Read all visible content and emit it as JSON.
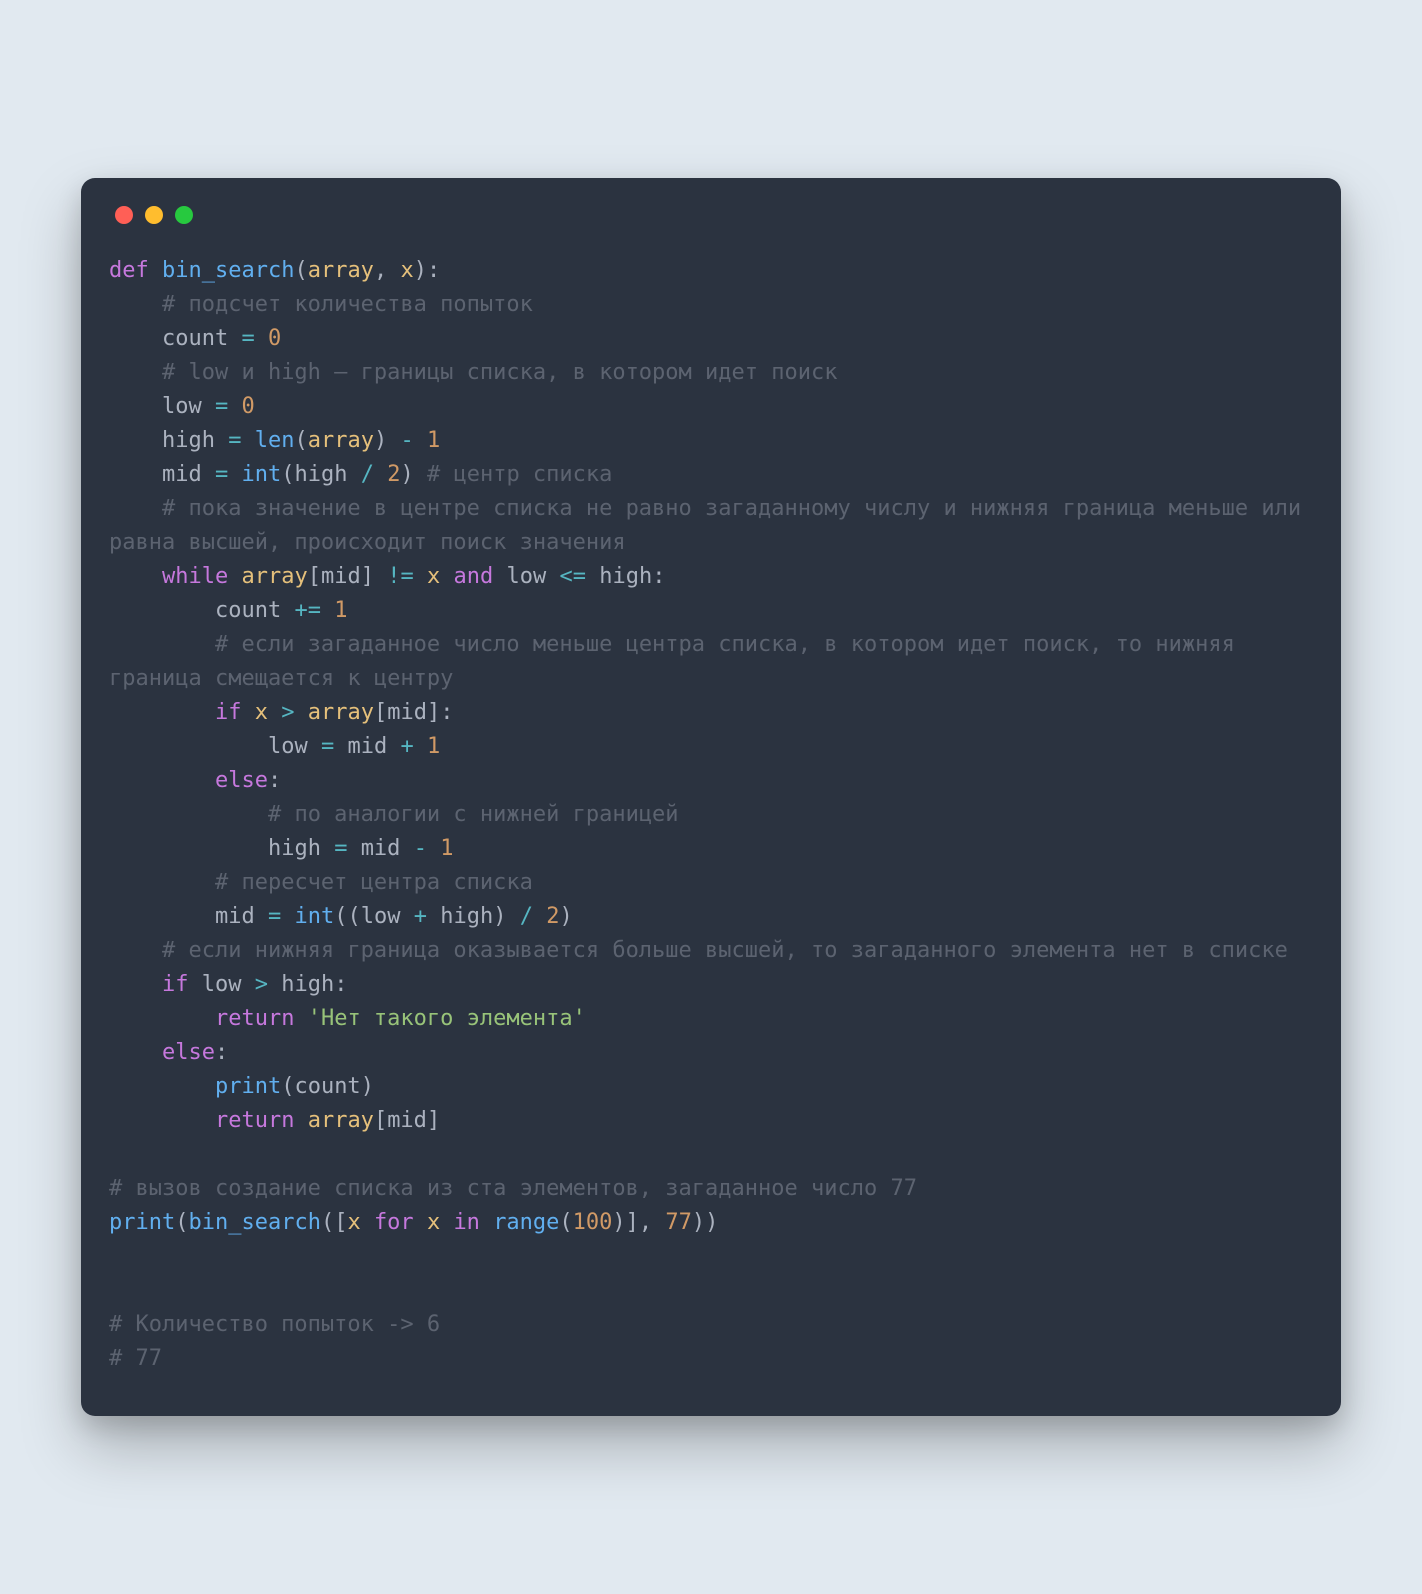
{
  "window": {
    "traffic_lights": [
      "red",
      "yellow",
      "green"
    ]
  },
  "code": {
    "l01": {
      "def": "def",
      "sp": " ",
      "fn": "bin_search",
      "lp": "(",
      "p1": "array",
      "c1": ",",
      "sp2": " ",
      "p2": "x",
      "rp": ")",
      "colon": ":"
    },
    "l02": {
      "indent": "    ",
      "cmt": "# подсчет количества попыток"
    },
    "l03": {
      "indent": "    ",
      "v": "count",
      "sp": " ",
      "eq": "=",
      "sp2": " ",
      "n": "0"
    },
    "l04": {
      "indent": "    ",
      "cmt": "# low и high – границы списка, в котором идет поиск"
    },
    "l05": {
      "indent": "    ",
      "v": "low",
      "sp": " ",
      "eq": "=",
      "sp2": " ",
      "n": "0"
    },
    "l06": {
      "indent": "    ",
      "v": "high",
      "sp": " ",
      "eq": "=",
      "sp2": " ",
      "len": "len",
      "lp": "(",
      "arr": "array",
      "rp": ")",
      "sp3": " ",
      "minus": "-",
      "sp4": " ",
      "n": "1"
    },
    "l07": {
      "indent": "    ",
      "v": "mid",
      "sp": " ",
      "eq": "=",
      "sp2": " ",
      "int": "int",
      "lp": "(",
      "high": "high",
      "sp3": " ",
      "div": "/",
      "sp4": " ",
      "n": "2",
      "rp": ")",
      "sp5": " ",
      "cmt": "# центр списка"
    },
    "l08": {
      "indent": "    ",
      "cmt": "# пока значение в центре списка не равно загаданному числу и нижняя граница меньше или равна высшей, происходит поиск значения"
    },
    "l09": {
      "indent": "    ",
      "while": "while",
      "sp": " ",
      "arr": "array",
      "lb": "[",
      "mid": "mid",
      "rb": "]",
      "sp2": " ",
      "ne": "!=",
      "sp3": " ",
      "x": "x",
      "sp4": " ",
      "and": "and",
      "sp5": " ",
      "low": "low",
      "sp6": " ",
      "le": "<=",
      "sp7": " ",
      "high": "high",
      "colon": ":"
    },
    "l10": {
      "indent": "        ",
      "v": "count",
      "sp": " ",
      "pe": "+=",
      "sp2": " ",
      "n": "1"
    },
    "l11": {
      "indent": "        ",
      "cmt": "# если загаданное число меньше центра списка, в котором идет поиск, то нижняя граница смещается к центру"
    },
    "l12": {
      "indent": "        ",
      "if": "if",
      "sp": " ",
      "x": "x",
      "sp2": " ",
      "gt": ">",
      "sp3": " ",
      "arr": "array",
      "lb": "[",
      "mid": "mid",
      "rb": "]",
      "colon": ":"
    },
    "l13": {
      "indent": "            ",
      "v": "low",
      "sp": " ",
      "eq": "=",
      "sp2": " ",
      "mid": "mid",
      "sp3": " ",
      "plus": "+",
      "sp4": " ",
      "n": "1"
    },
    "l14": {
      "indent": "        ",
      "else": "else",
      "colon": ":"
    },
    "l15": {
      "indent": "            ",
      "cmt": "# по аналогии с нижней границей"
    },
    "l16": {
      "indent": "            ",
      "v": "high",
      "sp": " ",
      "eq": "=",
      "sp2": " ",
      "mid": "mid",
      "sp3": " ",
      "minus": "-",
      "sp4": " ",
      "n": "1"
    },
    "l17": {
      "indent": "        ",
      "cmt": "# пересчет центра списка"
    },
    "l18": {
      "indent": "        ",
      "v": "mid",
      "sp": " ",
      "eq": "=",
      "sp2": " ",
      "int": "int",
      "lp": "(",
      "lp2": "(",
      "low": "low",
      "sp3": " ",
      "plus": "+",
      "sp4": " ",
      "high": "high",
      "rp2": ")",
      "sp5": " ",
      "div": "/",
      "sp6": " ",
      "n": "2",
      "rp": ")"
    },
    "l19": {
      "indent": "    ",
      "cmt": "# если нижняя граница оказывается больше высшей, то загаданного элемента нет в списке"
    },
    "l20": {
      "indent": "    ",
      "if": "if",
      "sp": " ",
      "low": "low",
      "sp2": " ",
      "gt": ">",
      "sp3": " ",
      "high": "high",
      "colon": ":"
    },
    "l21": {
      "indent": "        ",
      "ret": "return",
      "sp": " ",
      "str": "'Нет такого элемента'"
    },
    "l22": {
      "indent": "    ",
      "else": "else",
      "colon": ":"
    },
    "l23": {
      "indent": "        ",
      "pr": "print",
      "lp": "(",
      "cnt": "count",
      "rp": ")"
    },
    "l24": {
      "indent": "        ",
      "ret": "return",
      "sp": " ",
      "arr": "array",
      "lb": "[",
      "mid": "mid",
      "rb": "]"
    },
    "l25": {
      "blank": ""
    },
    "l26": {
      "cmt": "# вызов создание списка из ста элементов, загаданное число 77"
    },
    "l27": {
      "pr": "print",
      "lp": "(",
      "fn": "bin_search",
      "lp2": "(",
      "lb": "[",
      "x1": "x",
      "sp": " ",
      "for": "for",
      "sp2": " ",
      "x2": "x",
      "sp3": " ",
      "in": "in",
      "sp4": " ",
      "rng": "range",
      "lp3": "(",
      "n100": "100",
      "rp3": ")",
      "rb": "]",
      "c": ",",
      "sp5": " ",
      "n77": "77",
      "rp2": ")",
      "rp": ")"
    },
    "l28": {
      "blank": ""
    },
    "l29": {
      "blank": ""
    },
    "l30": {
      "cmt": "# Количество попыток -> 6"
    },
    "l31": {
      "cmt": "# 77"
    }
  }
}
